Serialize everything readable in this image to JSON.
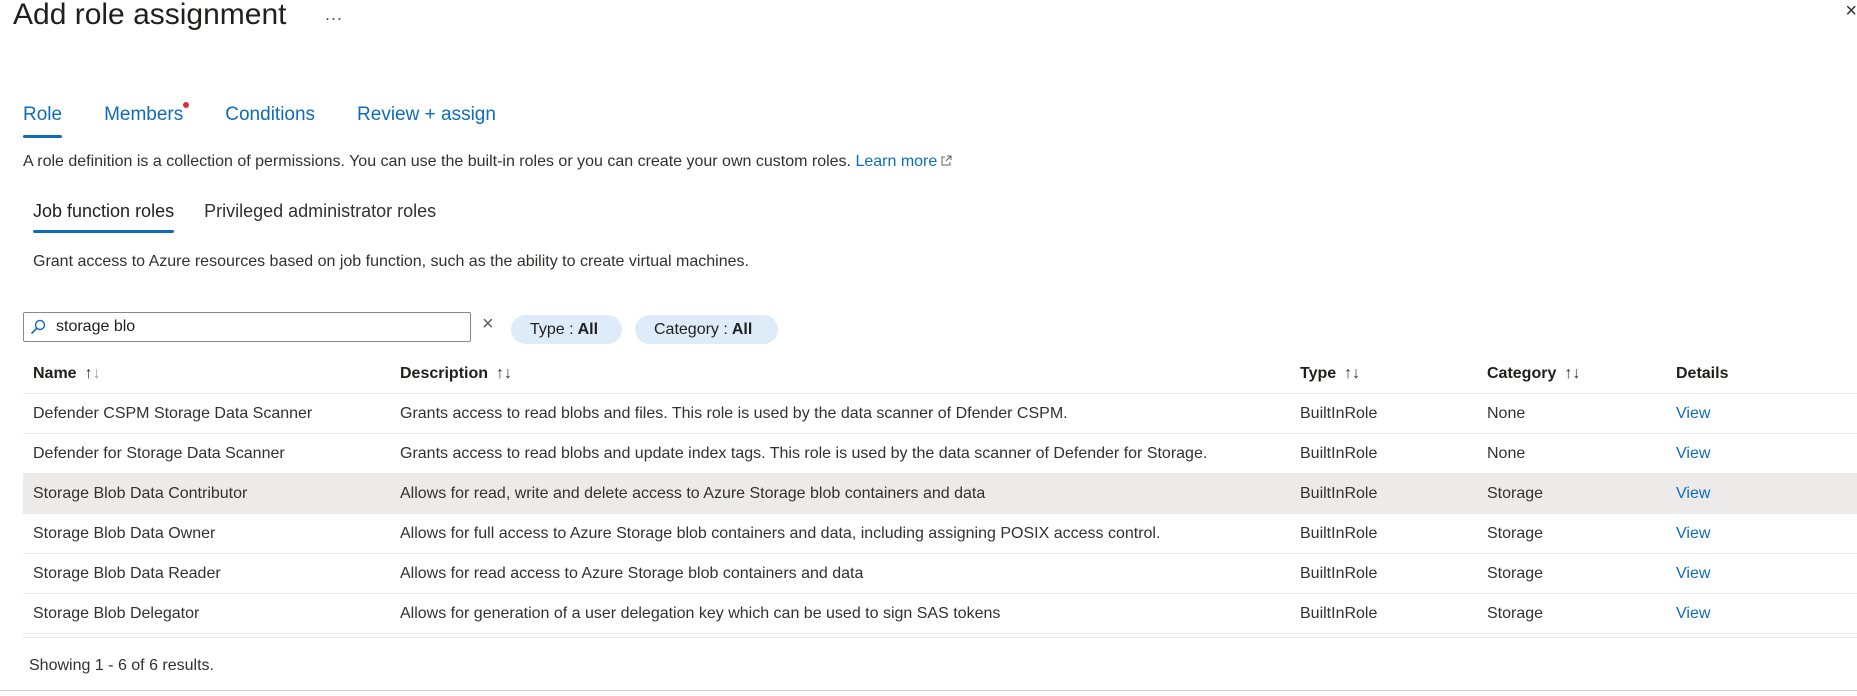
{
  "header": {
    "title": "Add role assignment",
    "more_label": "...",
    "close_label": "×"
  },
  "tabs": [
    {
      "label": "Role",
      "active": true
    },
    {
      "label": "Members",
      "required": true
    },
    {
      "label": "Conditions"
    },
    {
      "label": "Review + assign"
    }
  ],
  "role_description": {
    "text": "A role definition is a collection of permissions. You can use the built-in roles or you can create your own custom roles.",
    "link_label": "Learn more"
  },
  "subtabs": [
    {
      "label": "Job function roles",
      "active": true
    },
    {
      "label": "Privileged administrator roles"
    }
  ],
  "job_description": "Grant access to Azure resources based on job function, such as the ability to create virtual machines.",
  "search": {
    "value": "storage blo",
    "clear_label": "×"
  },
  "filters": {
    "type_label": "Type :",
    "type_value": "All",
    "category_label": "Category :",
    "category_value": "All"
  },
  "table": {
    "columns": {
      "name": "Name",
      "description": "Description",
      "type": "Type",
      "category": "Category",
      "details": "Details"
    },
    "rows": [
      {
        "name": "Defender CSPM Storage Data Scanner",
        "description": "Grants access to read blobs and files. This role is used by the data scanner of Dfender CSPM.",
        "type": "BuiltInRole",
        "category": "None",
        "details": "View"
      },
      {
        "name": "Defender for Storage Data Scanner",
        "description": "Grants access to read blobs and update index tags. This role is used by the data scanner of Defender for Storage.",
        "type": "BuiltInRole",
        "category": "None",
        "details": "View"
      },
      {
        "name": "Storage Blob Data Contributor",
        "description": "Allows for read, write and delete access to Azure Storage blob containers and data",
        "type": "BuiltInRole",
        "category": "Storage",
        "details": "View"
      },
      {
        "name": "Storage Blob Data Owner",
        "description": "Allows for full access to Azure Storage blob containers and data, including assigning POSIX access control.",
        "type": "BuiltInRole",
        "category": "Storage",
        "details": "View"
      },
      {
        "name": "Storage Blob Data Reader",
        "description": "Allows for read access to Azure Storage blob containers and data",
        "type": "BuiltInRole",
        "category": "Storage",
        "details": "View"
      },
      {
        "name": "Storage Blob Delegator",
        "description": "Allows for generation of a user delegation key which can be used to sign SAS tokens",
        "type": "BuiltInRole",
        "category": "Storage",
        "details": "View"
      }
    ]
  },
  "results_text": "Showing 1 - 6 of 6 results.",
  "colors": {
    "accent": "#0f6cbd",
    "pill_bg": "#deecf9",
    "selected_row": "#edebe9",
    "required_dot": "#d13438"
  },
  "icons": {
    "search": "search-icon",
    "external_link": "external-link-icon",
    "sort": "sort-icon"
  }
}
